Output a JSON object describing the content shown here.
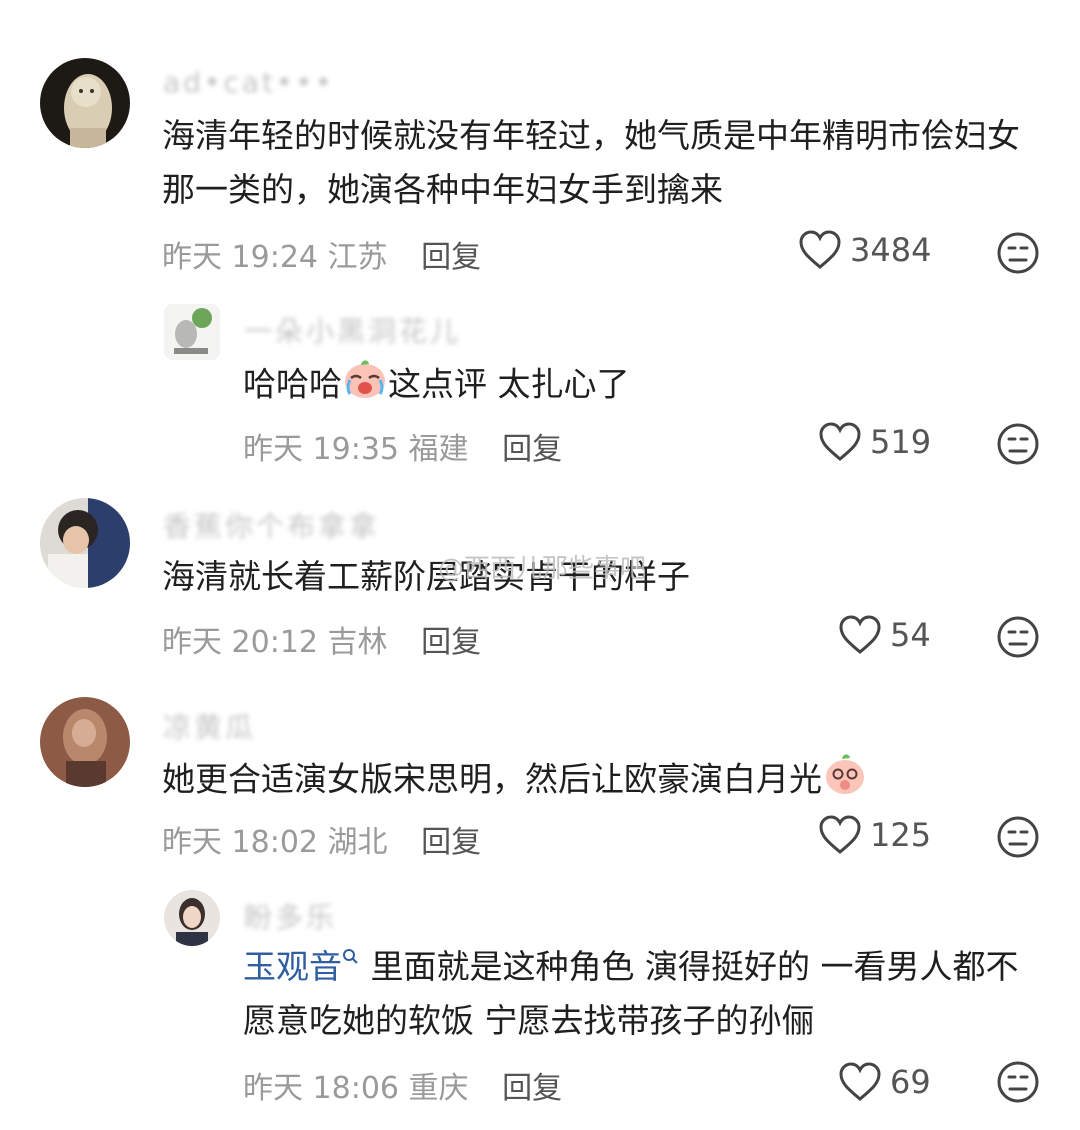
{
  "comments": [
    {
      "username": "ad•cat•••",
      "text": "海清年轻的时候就没有年轻过，她气质是中年精明市侩妇女那一类的，她演各种中年妇女手到擒来",
      "time": "昨天 19:24",
      "location": "江苏",
      "reply_label": "回复",
      "likes": "3484"
    },
    {
      "username": "一朵小黑洞花儿",
      "text_before": "哈哈哈",
      "emoji": "crying-laughing-emoji",
      "text_after": "这点评  太扎心了",
      "time": "昨天 19:35",
      "location": "福建",
      "reply_label": "回复",
      "likes": "519"
    },
    {
      "username": "香蕉你个布拿拿",
      "text": "海清就长着工薪阶层踏实肯干的样子",
      "time": "昨天 20:12",
      "location": "吉林",
      "reply_label": "回复",
      "likes": "54"
    },
    {
      "username": "凉黄瓜",
      "text": "她更合适演女版宋思明，然后让欧豪演白月光",
      "emoji": "shy-peach-emoji",
      "time": "昨天 18:02",
      "location": "湖北",
      "reply_label": "回复",
      "likes": "125"
    },
    {
      "username": "盼多乐",
      "mention": "玉观音",
      "text": "里面就是这种角色 演得挺好的 一看男人都不愿意吃她的软饭 宁愿去找带孩子的孙俪",
      "time": "昨天 18:06",
      "location": "重庆",
      "reply_label": "回复",
      "likes": "69"
    }
  ],
  "watermark": "@西西儿那些事吧",
  "icons": {
    "like": "heart-outline-icon",
    "dislike": "neutral-face-icon",
    "mention": "search-icon"
  },
  "colors": {
    "text": "#1f1f1f",
    "meta": "#9a9a9a",
    "mention": "#2f5fa0"
  }
}
